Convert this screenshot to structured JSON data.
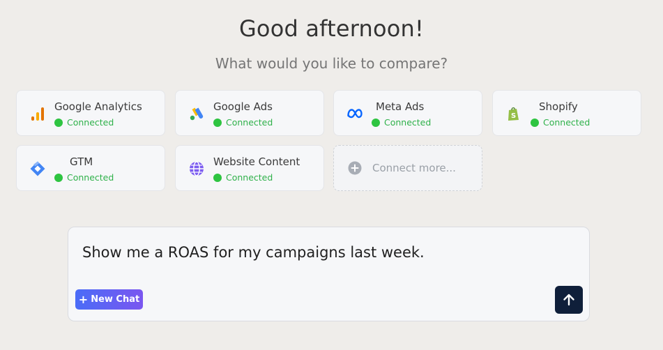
{
  "header": {
    "greeting": "Good afternoon!",
    "subtitle": "What would you like to compare?"
  },
  "integrations": [
    {
      "name": "Google Analytics",
      "status": "Connected",
      "icon": "google-analytics-icon"
    },
    {
      "name": "Google Ads",
      "status": "Connected",
      "icon": "google-ads-icon"
    },
    {
      "name": "Meta Ads",
      "status": "Connected",
      "icon": "meta-icon"
    },
    {
      "name": "Shopify",
      "status": "Connected",
      "icon": "shopify-icon"
    },
    {
      "name": "GTM",
      "status": "Connected",
      "icon": "gtm-icon"
    },
    {
      "name": "Website Content",
      "status": "Connected",
      "icon": "globe-icon"
    }
  ],
  "connect_more": {
    "label": "Connect more...",
    "icon": "plus-circle-icon"
  },
  "composer": {
    "prompt": "Show me a ROAS for my campaigns last week.",
    "new_chat_label": "New Chat",
    "send_icon": "arrow-up-icon"
  },
  "colors": {
    "status_green": "#2ec441",
    "send_bg": "#0f1f3a",
    "new_chat_gradient_start": "#4a6cf7",
    "new_chat_gradient_end": "#7a56f0"
  }
}
